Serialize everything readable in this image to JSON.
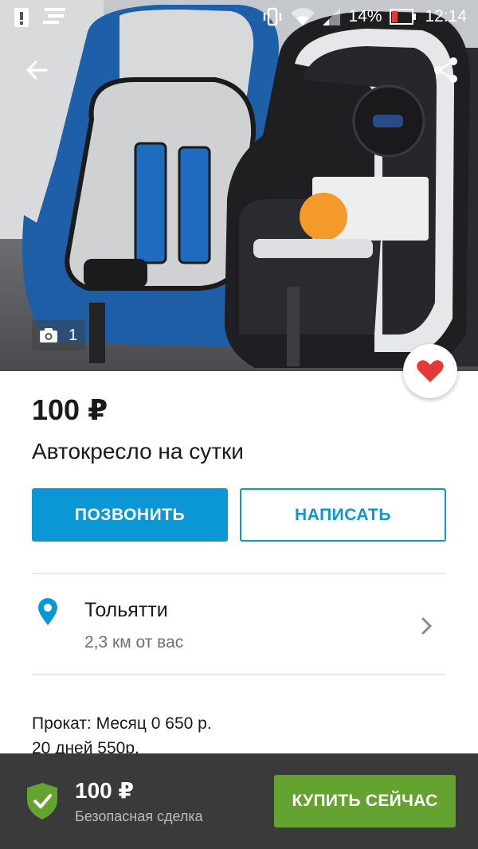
{
  "status_bar": {
    "battery_percent": "14%",
    "time": "12:14",
    "icons": [
      "alert-icon",
      "notification-icon",
      "vibrate-icon",
      "wifi-icon",
      "signal-icon",
      "battery-icon"
    ]
  },
  "toolbar": {
    "back_icon": "arrow-back-icon",
    "share_icon": "share-icon"
  },
  "gallery": {
    "photo_count": "1",
    "camera_icon": "camera-icon",
    "favorite_icon": "heart-icon",
    "favorite_color": "#e53935"
  },
  "listing": {
    "price": "100 ₽",
    "title": "Автокресло на сутки"
  },
  "actions": {
    "call_label": "ПОЗВОНИТЬ",
    "write_label": "НАПИСАТЬ",
    "accent_color": "#0b97d6"
  },
  "location": {
    "city": "Тольятти",
    "distance": "2,3 км от вас",
    "pin_icon": "location-pin-icon",
    "chevron_icon": "chevron-right-icon"
  },
  "description": {
    "line1": "Прокат: Месяц 0 650 р.",
    "line2": "20 дней 550р."
  },
  "bottom_bar": {
    "price": "100 ₽",
    "safe_deal": "Безопасная сделка",
    "buy_label": "КУПИТЬ СЕЙЧАС",
    "shield_icon": "shield-check-icon",
    "buy_color": "#64a32f"
  }
}
